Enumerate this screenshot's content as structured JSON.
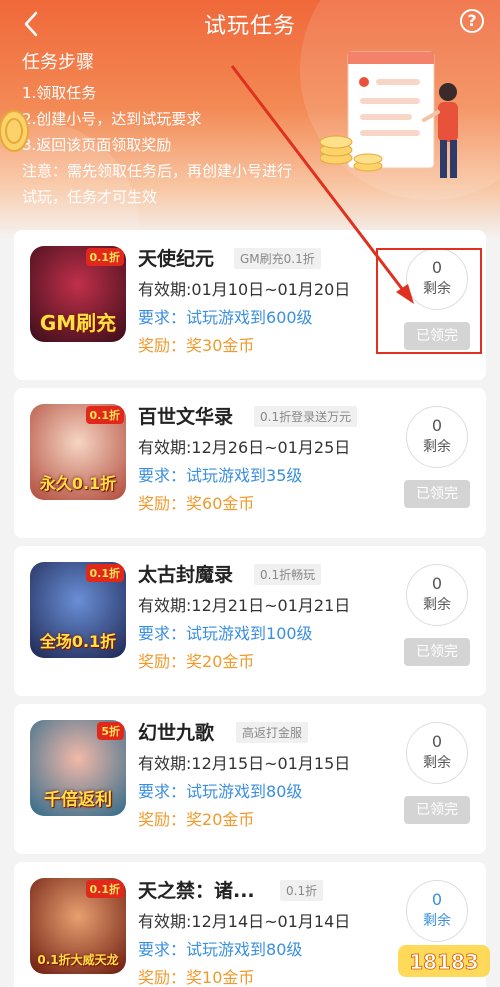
{
  "header": {
    "title": "试玩任务",
    "steps_title": "任务步骤",
    "steps": [
      "1.领取任务",
      "2.创建小号，达到试玩要求",
      "3.返回该页面领取奖励"
    ],
    "note": "注意：需先领取任务后，再创建小号进行试玩，任务才可生效"
  },
  "labels": {
    "validity_prefix": "有效期:",
    "require_prefix": "要求：",
    "reward_prefix": "奖励：",
    "remain_label": "剩余",
    "claimed_label": "已领完"
  },
  "tasks": [
    {
      "name": "天使纪元",
      "tag": "GM刷充0.1折",
      "validity": "01月10日~01月20日",
      "require": "试玩游戏到600级",
      "reward": "奖30金币",
      "remain": "0",
      "icon_badge": "0.1折",
      "icon_caption": "GM刷充"
    },
    {
      "name": "百世文华录",
      "tag": "0.1折登录送万元",
      "validity": "12月26日~01月25日",
      "require": "试玩游戏到35级",
      "reward": "奖60金币",
      "remain": "0",
      "icon_badge": "0.1折",
      "icon_caption": "永久0.1折"
    },
    {
      "name": "太古封魔录",
      "tag": "0.1折畅玩",
      "validity": "12月21日~01月21日",
      "require": "试玩游戏到100级",
      "reward": "奖20金币",
      "remain": "0",
      "icon_badge": "0.1折",
      "icon_caption": "全场0.1折"
    },
    {
      "name": "幻世九歌",
      "tag": "高返打金服",
      "validity": "12月15日~01月15日",
      "require": "试玩游戏到80级",
      "reward": "奖20金币",
      "remain": "0",
      "icon_badge": "5折",
      "icon_caption": "千倍返利"
    },
    {
      "name": "天之禁：诸...",
      "tag": "0.1折",
      "validity": "12月14日~01月14日",
      "require": "试玩游戏到80级",
      "reward": "奖10金币",
      "remain": "0",
      "icon_badge": "0.1折",
      "icon_caption": "0.1折大威天龙"
    }
  ],
  "watermark": "18183",
  "colors": {
    "header_orange": "#f0683a",
    "require_blue": "#3a8fe0",
    "reward_orange": "#f09a2c",
    "highlight_red": "#e0301e",
    "claimed_gray": "#d4d4d4"
  }
}
